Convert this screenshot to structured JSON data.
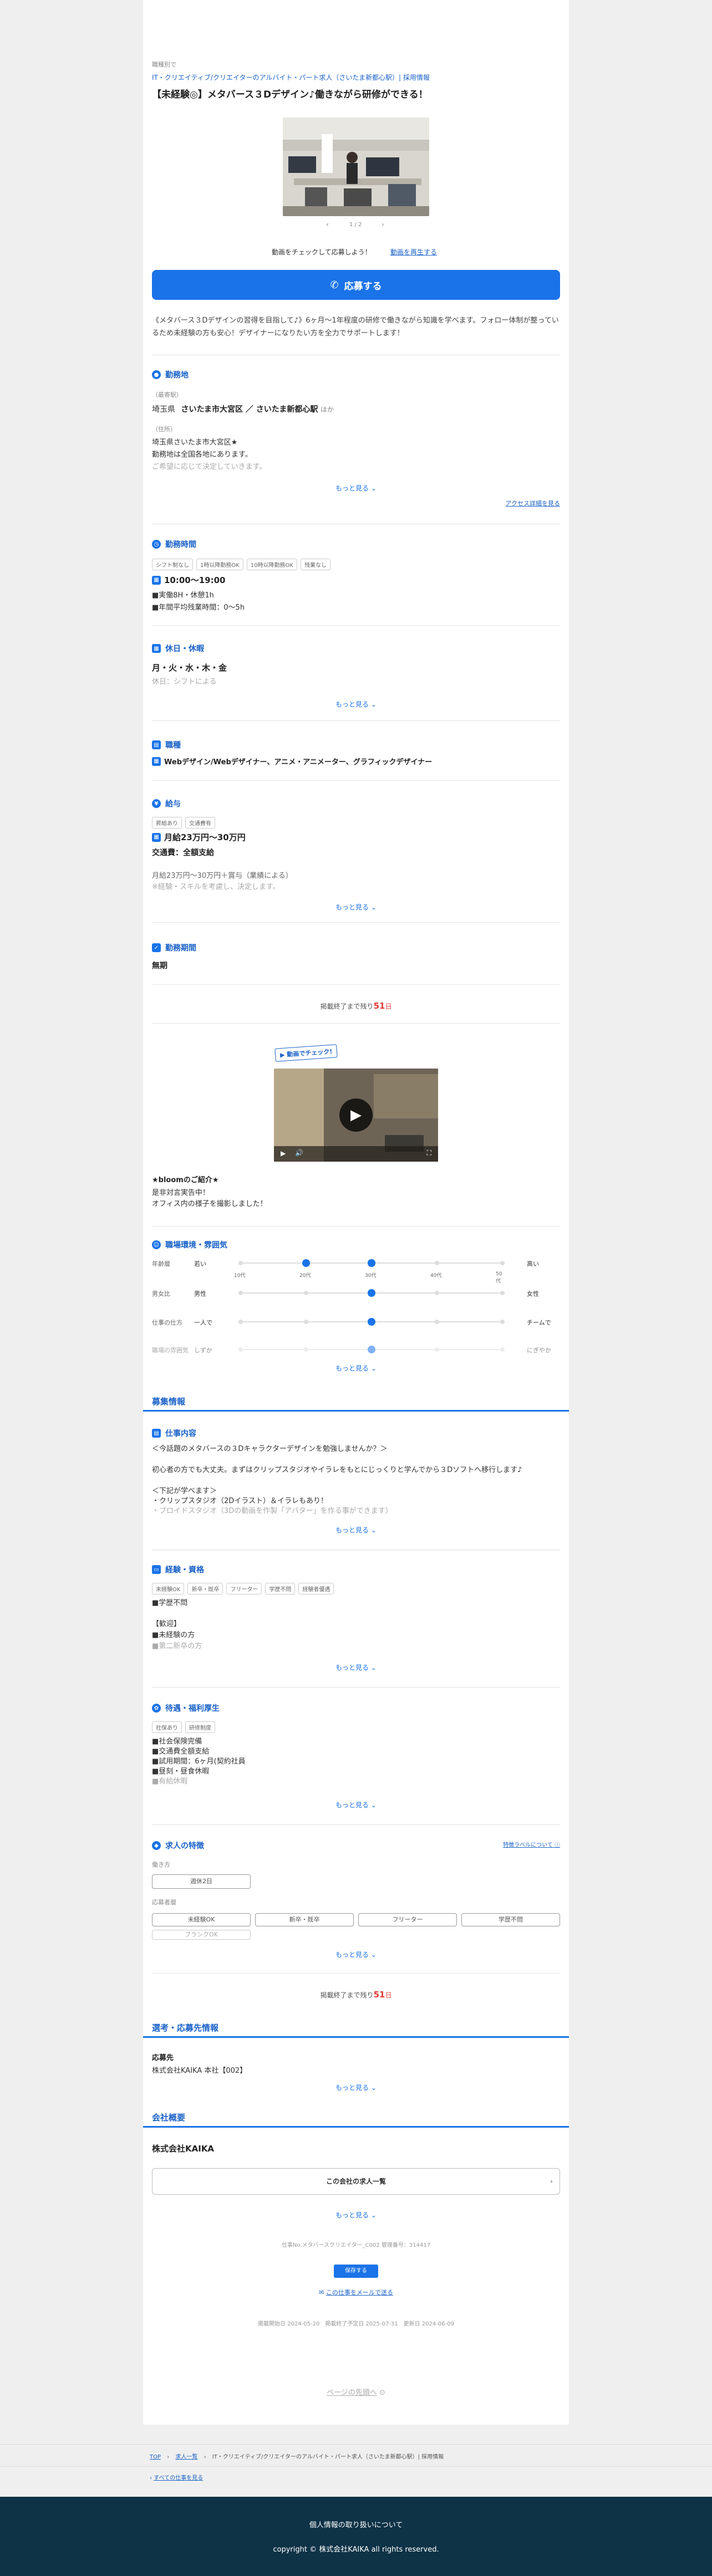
{
  "header": {
    "label": "職種別で",
    "breadcrumb_link": "IT・クリエイティブ/クリエイターのアルバイト・パート求人（さいたま新都心駅）| 採用情報",
    "title": "【未経験◎】メタバース３Dデザイン♪働きながら研修ができる！",
    "photo_counter": "1 / 2",
    "video_prompt": "動画をチェックして応募しよう！",
    "video_link": "動画を再生する",
    "apply_label": "応募する",
    "intro": "《メタバース３Dデザインの習得を目指して♪》6ヶ月〜1年程度の研修で働きながら知識を学べます。フォロー体制が整っているため未経験の方も安心！デザイナーになりたい方を全力でサポートします！"
  },
  "location": {
    "heading": "勤務地",
    "sub1": "（最寄駅）",
    "pref": "埼玉県",
    "station": "さいたま市大宮区 ／ さいたま新都心駅",
    "station_suffix": "ほか",
    "sub2": "（住所）",
    "addr1": "埼玉県さいたま市大宮区★",
    "addr2": "勤務地は全国各地にあります。",
    "addr3": "ご希望に応じて決定していきます。",
    "more": "もっと見る",
    "access_link": "アクセス詳細を見る"
  },
  "hours": {
    "heading": "勤務時間",
    "tags": [
      "シフト制なし",
      "1時以降勤務OK",
      "10時以降勤務OK",
      "残業なし"
    ],
    "time": "10:00〜19:00",
    "line1": "■実働8H・休憩1h",
    "line2": "■年間平均残業時間：0〜5h"
  },
  "holiday": {
    "heading": "休日・休暇",
    "days": "月・火・水・木・金",
    "note": "休日：シフトによる",
    "more": "もっと見る"
  },
  "job": {
    "heading": "職種",
    "value": "Webデザイン/Webデザイナー、アニメ・アニメーター、グラフィックデザイナー"
  },
  "salary": {
    "heading": "給与",
    "tags": [
      "昇給あり",
      "交通費有"
    ],
    "amount": "月給23万円〜30万円",
    "transport": "交通費：全額支給",
    "line1": "月給23万円〜30万円＋賞与（業績による）",
    "line2": "※経験・スキルを考慮し、決定します。",
    "more": "もっと見る"
  },
  "period": {
    "heading": "勤務期間",
    "value": "無期"
  },
  "deadline1": {
    "text": "掲載終了まで残り",
    "days": "51",
    "unit": "日"
  },
  "video": {
    "badge": "動画でチェック!",
    "caption_title": "★bloomのご紹介★",
    "caption1": "是非対言実告中！",
    "caption2": "オフィス内の様子を撮影しました！"
  },
  "env": {
    "heading": "職場環境・雰囲気",
    "rows": [
      {
        "label": "年齢層",
        "left": "若い",
        "right": "高い",
        "value": 0.5
      },
      {
        "label": "男女比",
        "left": "男性",
        "right": "女性",
        "value": 0.5
      },
      {
        "label": "仕事の仕方",
        "left": "一人で",
        "right": "チームで",
        "value": 0.5
      },
      {
        "label": "職場の雰囲気",
        "left": "しずか",
        "right": "にぎやか",
        "value": 0.5
      }
    ],
    "scale": [
      "10代",
      "20代",
      "30代",
      "40代",
      "50代"
    ],
    "more": "もっと見る"
  },
  "recruit": {
    "band_title": "募集情報",
    "content_heading": "仕事内容",
    "content1": "＜今話題のメタバースの３Dキャラクターデザインを勉強しませんか？＞",
    "content2": "初心者の方でも大丈夫。まずはクリップスタジオやイラレをもとにじっくりと学んでから３Dソフトへ移行します♪",
    "content3": "＜下記が学べます＞",
    "content4": "・クリップスタジオ（2Dイラスト）＆イラレもあり！",
    "content5": "・ブロイドスタジオ（3Dの動画を作製「アバター」を作る事ができます）",
    "more": "もっと見る",
    "exp_heading": "経験・資格",
    "exp_tags": [
      "未経験OK",
      "新卒・既卒",
      "フリーター",
      "学歴不問",
      "経験者優遇"
    ],
    "exp1": "■学歴不問",
    "exp2": "【歓迎】",
    "exp3": "■未経験の方",
    "exp4": "■第二新卒の方",
    "welfare_heading": "待遇・福利厚生",
    "welfare_tags": [
      "社保あり",
      "研修制度"
    ],
    "welfare1": "■社会保険完備",
    "welfare2": "■交通費全額支給",
    "welfare3": "■試用期間：6ヶ月(契約社員",
    "welfare4": "■昼刻・昼食休暇",
    "welfare5": "■有給休暇",
    "feature_heading": "求人の特徴",
    "feature_link": "特徴ラベルについて",
    "feature_sub1": "働き方",
    "feature_tag1": "週休2日",
    "feature_sub2": "応募者層",
    "feature_tags2": [
      "未経験OK",
      "新卒・既卒",
      "フリーター",
      "学歴不問"
    ],
    "feature_tag3": "ブランクOK"
  },
  "deadline2": {
    "text": "掲載終了まで残り",
    "days": "51",
    "unit": "日"
  },
  "apply_info": {
    "band_title": "選考・応募先情報",
    "heading": "応募先",
    "value": "株式会社KAIKA 本社【002】",
    "more": "もっと見る"
  },
  "company": {
    "band_title": "会社概要",
    "name": "株式会社KAIKA",
    "jobs_button": "この会社の求人一覧",
    "more": "もっと見る",
    "meta": "仕事No.メタバースクリエイター_C002 管理番号：314417",
    "save_button": "保存する",
    "mail_link": "この仕事をメールで送る",
    "dates": "掲載開始日 2024-05-20　掲載終了予定日 2025-07-31　更新日 2024-06-09",
    "top_link": "ページの先頭へ"
  },
  "footer": {
    "crumb_top": "TOP",
    "crumb_list": "求人一覧",
    "crumb_current": "IT・クリエイティブ/クリエイターのアルバイト・パート求人（さいたま新都心駅）| 採用情報",
    "back_link": "すべての仕事を見る",
    "privacy": "個人情報の取り扱いについて",
    "copyright": "copyright © 株式会社KAIKA all rights reserved."
  }
}
